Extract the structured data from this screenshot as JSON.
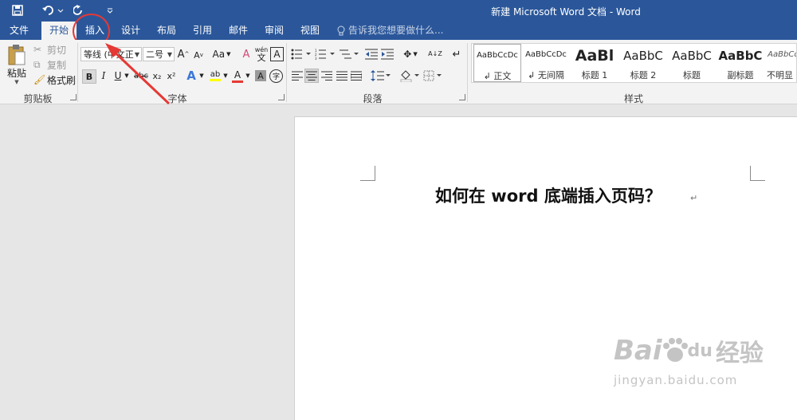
{
  "window": {
    "title": "新建 Microsoft Word 文档 - Word"
  },
  "quick_access": {
    "save_icon": "save-icon",
    "undo_icon": "undo-icon",
    "redo_icon": "redo-icon",
    "customize_icon": "customize-icon"
  },
  "tabs": [
    {
      "label": "文件"
    },
    {
      "label": "开始"
    },
    {
      "label": "插入"
    },
    {
      "label": "设计"
    },
    {
      "label": "布局"
    },
    {
      "label": "引用"
    },
    {
      "label": "邮件"
    },
    {
      "label": "审阅"
    },
    {
      "label": "视图"
    }
  ],
  "active_tab": "开始",
  "tell_me": {
    "placeholder": "告诉我您想要做什么..."
  },
  "clipboard": {
    "paste_label": "粘贴",
    "cut_label": "剪切",
    "copy_label": "复制",
    "format_painter_label": "格式刷",
    "group_label": "剪贴板"
  },
  "font": {
    "font_name": "等线 (中文正",
    "font_size": "二号",
    "grow": "A",
    "shrink": "A",
    "change_case": "Aa",
    "clear_format": "A",
    "phonetic_top": "wén",
    "phonetic_bottom": "文",
    "char_border": "A",
    "bold": "B",
    "italic": "I",
    "underline": "U",
    "strike": "abc",
    "subscript": "x₂",
    "superscript": "x²",
    "text_effects": "A",
    "highlight": "ab",
    "font_color": "A",
    "char_shading": "A",
    "enclose": "字",
    "group_label": "字体"
  },
  "paragraph": {
    "group_label": "段落",
    "sort": "A↓Z",
    "show_marks": "↵"
  },
  "styles": {
    "items": [
      {
        "sample": "AaBbCcDc",
        "name": "↲ 正文"
      },
      {
        "sample": "AaBbCcDc",
        "name": "↲ 无间隔"
      },
      {
        "sample": "AaBl",
        "name": "标题 1"
      },
      {
        "sample": "AaBbC",
        "name": "标题 2"
      },
      {
        "sample": "AaBbC",
        "name": "标题"
      },
      {
        "sample": "AaBbC",
        "name": "副标题"
      },
      {
        "sample": "AaBbCc",
        "name": "不明显强"
      }
    ],
    "group_label": "样式"
  },
  "document": {
    "heading": "如何在 word 底端插入页码？",
    "paragraph_mark": "↵"
  },
  "watermark": {
    "brand": "Bai",
    "brand2": "du",
    "brand_cn": "经验",
    "url": "jingyan.baidu.com"
  },
  "colors": {
    "title_bar": "#2b579a",
    "ribbon": "#f3f3f3",
    "annotation": "#e53935",
    "font_color_bar": "#e53935",
    "highlight_bar": "#ffff00"
  }
}
